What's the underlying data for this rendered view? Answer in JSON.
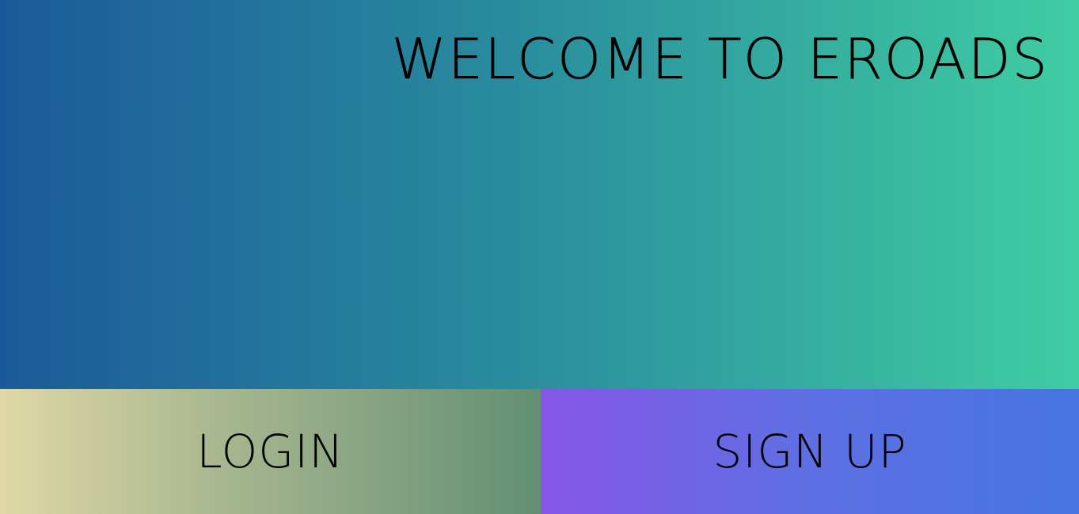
{
  "hero": {
    "title": "WELCOME TO EROADS"
  },
  "actions": {
    "login_label": "LOGIN",
    "signup_label": "SIGN UP"
  },
  "colors": {
    "hero_gradient_start": "#1b5a9a",
    "hero_gradient_mid": "#2a8f9e",
    "hero_gradient_end": "#40cda2",
    "login_gradient_start": "#dfd8a6",
    "login_gradient_end": "#628f72",
    "signup_gradient_start": "#8656e6",
    "signup_gradient_end": "#4674e1"
  }
}
